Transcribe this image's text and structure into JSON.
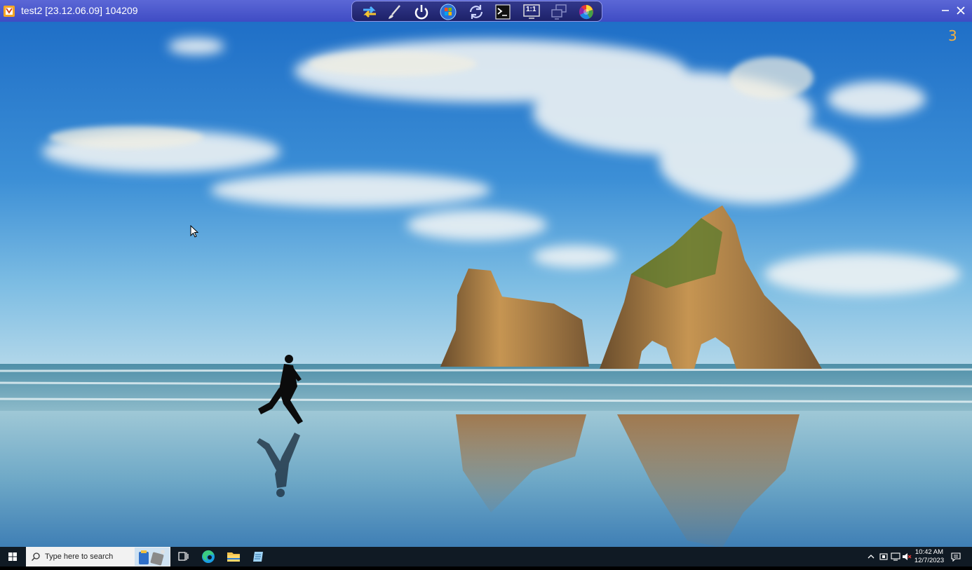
{
  "window": {
    "title": "test2 [23.12.06.09] 104209",
    "logo_icon": "remote-app-logo-icon",
    "minimize_icon": "minimize-icon",
    "close_icon": "close-icon"
  },
  "remote_toolbar": {
    "buttons": [
      {
        "icon": "switch-arrows-icon"
      },
      {
        "icon": "brush-icon"
      },
      {
        "icon": "power-icon"
      },
      {
        "icon": "windows-start-orb-icon"
      },
      {
        "icon": "refresh-icon"
      },
      {
        "icon": "terminal-icon"
      },
      {
        "icon": "actual-size-icon",
        "label": "1:1"
      },
      {
        "icon": "multi-monitor-icon"
      },
      {
        "icon": "color-wheel-icon"
      }
    ]
  },
  "desktop": {
    "monitor_number": "3",
    "wallpaper": "beach-rocks-runner-wallpaper"
  },
  "taskbar": {
    "start_icon": "windows-start-icon",
    "search_placeholder": "Type here to search",
    "search_icon": "search-icon",
    "pinned": [
      {
        "icon": "task-view-icon"
      },
      {
        "icon": "edge-browser-icon"
      },
      {
        "icon": "file-explorer-icon"
      },
      {
        "icon": "notepad-icon"
      }
    ],
    "tray_icons": [
      "chevron-up-icon",
      "device-icon",
      "network-icon",
      "volume-muted-icon"
    ],
    "time": "10:42 AM",
    "date": "12/7/2023",
    "notification_icon": "notification-icon"
  },
  "colors": {
    "titlebar": "#4a56cd",
    "taskbar": "#101a24",
    "monitor_number": "#f4b13f"
  }
}
